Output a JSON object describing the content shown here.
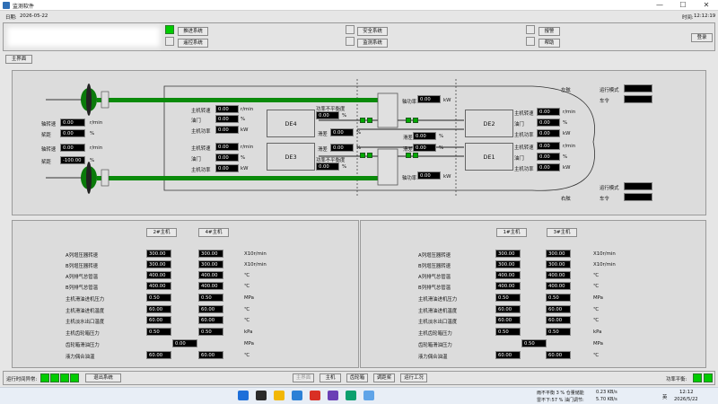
{
  "window": {
    "title": "监测软件",
    "min": "—",
    "max": "☐",
    "close": "✕"
  },
  "header": {
    "date_label": "日期:",
    "date": "2026-05-22",
    "time_label": "时间:",
    "time": "12:12:19"
  },
  "systems": {
    "propulsion": "推进系统",
    "remote": "遥控系统",
    "safety": "安全系统",
    "monitor": "监测系统",
    "alarm": "报警",
    "help": "帮助",
    "login": "登录"
  },
  "tab": {
    "main": "主界面"
  },
  "ship": {
    "port": "左舷",
    "starboard": "右舷",
    "run_mode": "运行模式",
    "telegraph": "车令",
    "left_shaft": {
      "speed_label": "轴转速",
      "speed": "0.00",
      "speed_unit": "r/min",
      "pitch_label": "桨距",
      "pitch": "0.00",
      "pitch_unit": "%"
    },
    "right_shaft": {
      "speed_label": "轴转速",
      "speed": "0.00",
      "speed_unit": "r/min",
      "pitch_label": "桨距",
      "pitch": "-100.00",
      "pitch_unit": "%"
    },
    "shaft_power_label": "轴功率",
    "shaft_power_unit": "kW",
    "shaft_power_top": "0.00",
    "shaft_power_bottom": "0.00",
    "imbalance_label": "功率不平衡度",
    "imbalance_unit": "%",
    "slip_label": "滑差",
    "slip_unit": "%",
    "de4": {
      "name": "DE4",
      "speed_label": "主机转速",
      "speed": "0.00",
      "speed_unit": "r/min",
      "oil_label": "油门",
      "oil": "0.00",
      "oil_unit": "%",
      "power_label": "主机功率",
      "power": "0.00",
      "power_unit": "kW",
      "imbalance": "0.00",
      "slip": "0.00"
    },
    "de3": {
      "name": "DE3",
      "speed_label": "主机转速",
      "speed": "0.00",
      "speed_unit": "r/min",
      "oil_label": "油门",
      "oil": "0.00",
      "oil_unit": "%",
      "power_label": "主机功率",
      "power": "0.00",
      "power_unit": "kW",
      "imbalance": "0.00",
      "slip": "0.00"
    },
    "de2": {
      "name": "DE2",
      "speed_label": "主机转速",
      "speed": "0.00",
      "speed_unit": "r/min",
      "oil_label": "油门",
      "oil": "0.00",
      "oil_unit": "%",
      "power_label": "主机功率",
      "power": "0.00",
      "power_unit": "kW",
      "slip": "0.00"
    },
    "de1": {
      "name": "DE1",
      "speed_label": "主机转速",
      "speed": "0.00",
      "speed_unit": "r/min",
      "oil_label": "油门",
      "oil": "0.00",
      "oil_unit": "%",
      "power_label": "主机功率",
      "power": "0.00",
      "power_unit": "kW",
      "slip": "0.00"
    }
  },
  "params": {
    "labels": [
      "A列增压器转速",
      "B列增压器转速",
      "A列排气总管温",
      "B列排气总管温",
      "主机滑油进机压力",
      "主机滑油进机温度",
      "主机淡水出口温度",
      "主机齿轮箱压力",
      "齿轮箱滑油压力",
      "液力偶合油温"
    ],
    "units": [
      "X10r/min",
      "X10r/min",
      "℃",
      "℃",
      "MPa",
      "℃",
      "℃",
      "kPa",
      "MPa",
      "℃"
    ],
    "left": {
      "btn_a": "2#主机",
      "btn_b": "4#主机",
      "col_a": [
        "300.00",
        "300.00",
        "400.00",
        "400.00",
        "0.50",
        "60.00",
        "60.00",
        "0.50",
        "",
        "60.00"
      ],
      "col_b": [
        "300.00",
        "300.00",
        "400.00",
        "400.00",
        "0.50",
        "60.00",
        "60.00",
        "0.50",
        "",
        "60.00"
      ],
      "mid": "0.00"
    },
    "right": {
      "btn_a": "1#主机",
      "btn_b": "3#主机",
      "col_a": [
        "300.00",
        "300.00",
        "400.00",
        "400.00",
        "0.50",
        "60.00",
        "60.00",
        "0.50",
        "",
        "60.00"
      ],
      "col_b": [
        "300.00",
        "300.00",
        "400.00",
        "400.00",
        "0.50",
        "60.00",
        "60.00",
        "0.50",
        "",
        "60.00"
      ],
      "mid": "0.50"
    }
  },
  "footer": {
    "runtime_label": "运行时间异常:",
    "exit": "退出系统",
    "nav": [
      "主界面",
      "主机",
      "齿轮箱",
      "调距桨",
      "运行工况"
    ],
    "power_balance": "功率平衡:"
  },
  "taskbar": {
    "weather1": "雨不平衡 3 % 仓量储能",
    "weather2": "雷不下:57 % 油门调节:",
    "net1": "0.23 KB/s",
    "net2": "5.70 KB/s",
    "lang": "英",
    "clock": "12:12",
    "date": "2026/5/22"
  }
}
